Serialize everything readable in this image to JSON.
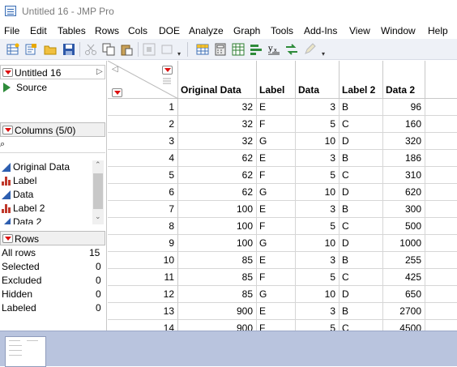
{
  "window": {
    "title": "Untitled 16 - JMP Pro"
  },
  "menu": [
    "File",
    "Edit",
    "Tables",
    "Rows",
    "Cols",
    "DOE",
    "Analyze",
    "Graph",
    "Tools",
    "Add-Ins",
    "View",
    "Window",
    "Help"
  ],
  "table_panel": {
    "name": "Untitled 16",
    "source_label": "Source"
  },
  "columns_panel": {
    "title": "Columns (5/0)",
    "search_icon_glyph": "⌕",
    "items": [
      {
        "label": "Original Data",
        "type": "continuous"
      },
      {
        "label": "Label",
        "type": "nominal"
      },
      {
        "label": "Data",
        "type": "continuous"
      },
      {
        "label": "Label 2",
        "type": "nominal"
      },
      {
        "label": "Data 2",
        "type": "continuous"
      }
    ]
  },
  "rows_panel": {
    "title": "Rows",
    "items": [
      {
        "label": "All rows",
        "value": "15"
      },
      {
        "label": "Selected",
        "value": "0"
      },
      {
        "label": "Excluded",
        "value": "0"
      },
      {
        "label": "Hidden",
        "value": "0"
      },
      {
        "label": "Labeled",
        "value": "0"
      }
    ]
  },
  "table": {
    "columns": [
      "Original Data",
      "Label",
      "Data",
      "Label 2",
      "Data 2"
    ],
    "rows": [
      [
        "1",
        "32",
        "E",
        "3",
        "B",
        "96"
      ],
      [
        "2",
        "32",
        "F",
        "5",
        "C",
        "160"
      ],
      [
        "3",
        "32",
        "G",
        "10",
        "D",
        "320"
      ],
      [
        "4",
        "62",
        "E",
        "3",
        "B",
        "186"
      ],
      [
        "5",
        "62",
        "F",
        "5",
        "C",
        "310"
      ],
      [
        "6",
        "62",
        "G",
        "10",
        "D",
        "620"
      ],
      [
        "7",
        "100",
        "E",
        "3",
        "B",
        "300"
      ],
      [
        "8",
        "100",
        "F",
        "5",
        "C",
        "500"
      ],
      [
        "9",
        "100",
        "G",
        "10",
        "D",
        "1000"
      ],
      [
        "10",
        "85",
        "E",
        "3",
        "B",
        "255"
      ],
      [
        "11",
        "85",
        "F",
        "5",
        "C",
        "425"
      ],
      [
        "12",
        "85",
        "G",
        "10",
        "D",
        "650"
      ],
      [
        "13",
        "900",
        "E",
        "3",
        "B",
        "2700"
      ],
      [
        "14",
        "900",
        "F",
        "5",
        "C",
        "4500"
      ]
    ]
  },
  "toolbar_icons": [
    "new-table-icon",
    "open-icon",
    "open-folder-icon",
    "save-icon",
    "cut-icon",
    "copy-icon",
    "paste-icon",
    "tool-dim-icon",
    "tool-dim2-icon",
    "data-grid-icon",
    "calculator-icon",
    "tabulate-icon",
    "bar-chart-icon",
    "formula-icon",
    "arrow-icon",
    "pen-icon"
  ]
}
